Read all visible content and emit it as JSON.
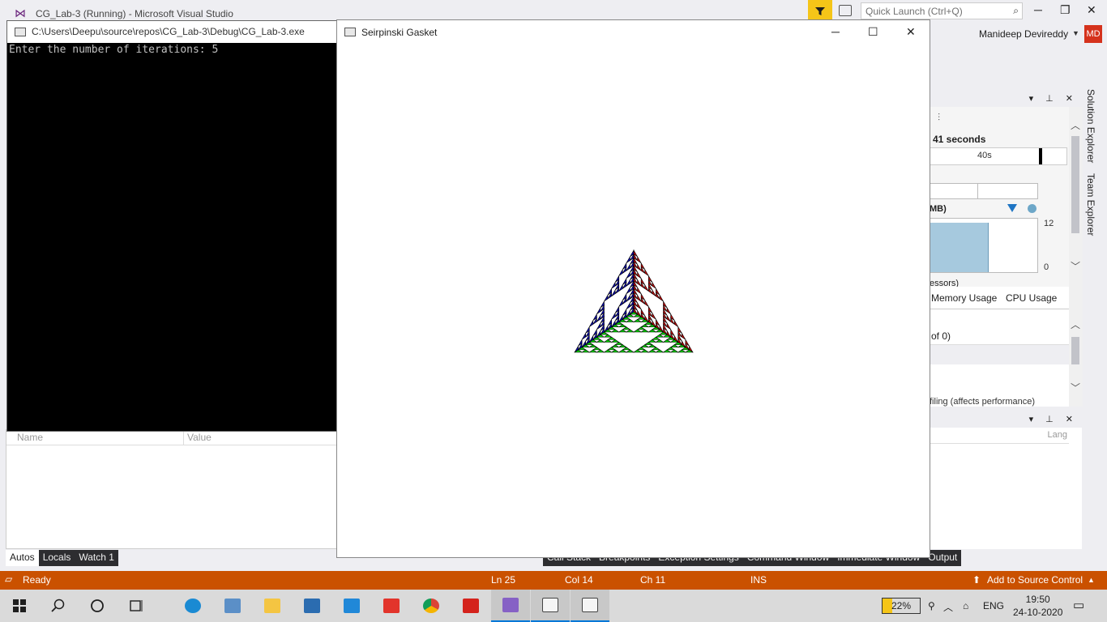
{
  "vs": {
    "title": "CG_Lab-3 (Running) - Microsoft Visual Studio",
    "quick_launch_placeholder": "Quick Launch (Ctrl+Q)",
    "user_name": "Manideep Devireddy",
    "user_initials": "MD"
  },
  "console": {
    "title": "C:\\Users\\Deepu\\source\\repos\\CG_Lab-3\\Debug\\CG_Lab-3.exe",
    "output": "Enter the number of iterations: 5"
  },
  "glut": {
    "title": "Seirpinski Gasket",
    "minimize": "─",
    "maximize": "☐",
    "close": "✕",
    "colors": {
      "face_left": "#0000b0",
      "face_right": "#c00000",
      "face_bottom": "#00cc00",
      "edge": "#000000"
    }
  },
  "diagnostics": {
    "session_time": "41 seconds",
    "timeline_tick": "40s",
    "process_memory_label": "MB)",
    "y_max": "12",
    "y_min": "0",
    "processors_label": "essors)",
    "tabs": [
      "Memory Usage",
      "CPU Usage"
    ],
    "events_summary": "of 0)",
    "profiling_note": "filing (affects performance)"
  },
  "side_tabs": [
    "Solution Explorer",
    "Team Explorer"
  ],
  "call_stack_panel": {
    "lang_column": "Lang"
  },
  "autos": {
    "columns": [
      "Name",
      "Value"
    ],
    "tabs": [
      "Autos",
      "Locals",
      "Watch 1"
    ]
  },
  "right_debug_tabs": [
    "Call Stack",
    "Breakpoints",
    "Exception Settings",
    "Command Window",
    "Immediate Window",
    "Output"
  ],
  "statusbar": {
    "ready": "Ready",
    "ln": "Ln 25",
    "col": "Col 14",
    "ch": "Ch 11",
    "ins": "INS",
    "source_control": "Add to Source Control"
  },
  "taskbar": {
    "battery": "22%",
    "language": "ENG",
    "time": "19:50",
    "date": "24-10-2020"
  }
}
